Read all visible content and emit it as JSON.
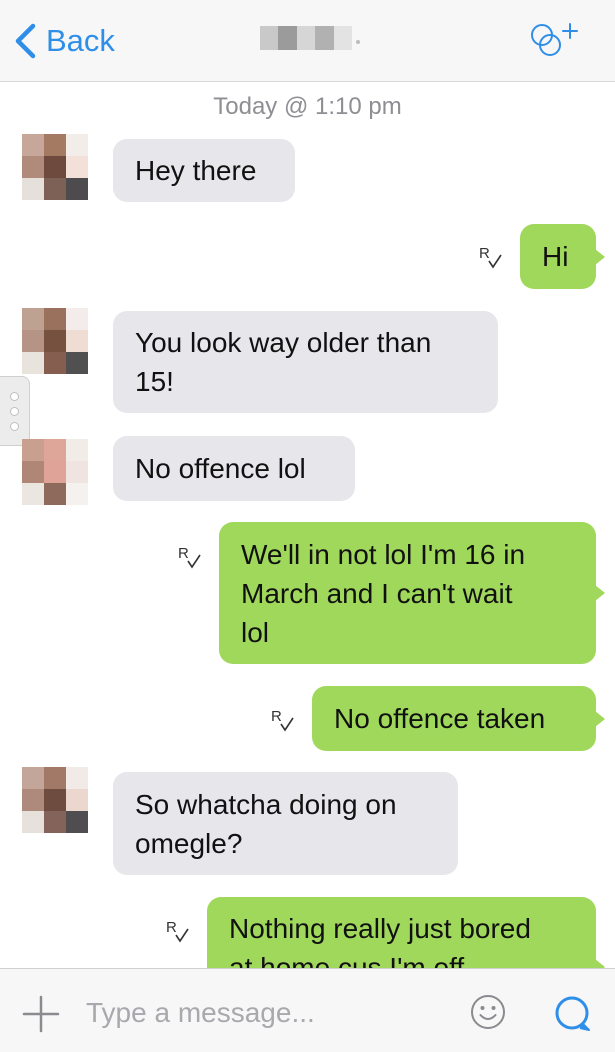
{
  "header": {
    "back_label": "Back",
    "back_icon": "chevron-left-icon",
    "add_people_icon": "add-people-icon",
    "accent_color": "#2f8fe8"
  },
  "conversation": {
    "date_label": "Today @ 1:10 pm",
    "incoming_bubble_color": "#e6e6eb",
    "outgoing_bubble_color": "#9fd85b",
    "messages": [
      {
        "direction": "incoming",
        "text": "Hey there"
      },
      {
        "direction": "outgoing",
        "text": "Hi",
        "receipt": "R"
      },
      {
        "direction": "incoming",
        "text": "You look way older than\n15!"
      },
      {
        "direction": "incoming",
        "text": "No offence lol"
      },
      {
        "direction": "outgoing",
        "text": "We'll in not lol I'm 16 in\nMarch and I can't wait\nlol",
        "receipt": "R"
      },
      {
        "direction": "outgoing",
        "text": "No offence taken",
        "receipt": "R"
      },
      {
        "direction": "incoming",
        "text": "So whatcha doing on\nomegle?"
      },
      {
        "direction": "outgoing",
        "text": "Nothing really just bored\nat home cus I'm off",
        "receipt": "R"
      }
    ]
  },
  "composer": {
    "placeholder": "Type a message...",
    "plus_icon": "plus-icon",
    "emoji_icon": "smiley-icon",
    "chat_icon": "chat-bubble-icon"
  }
}
